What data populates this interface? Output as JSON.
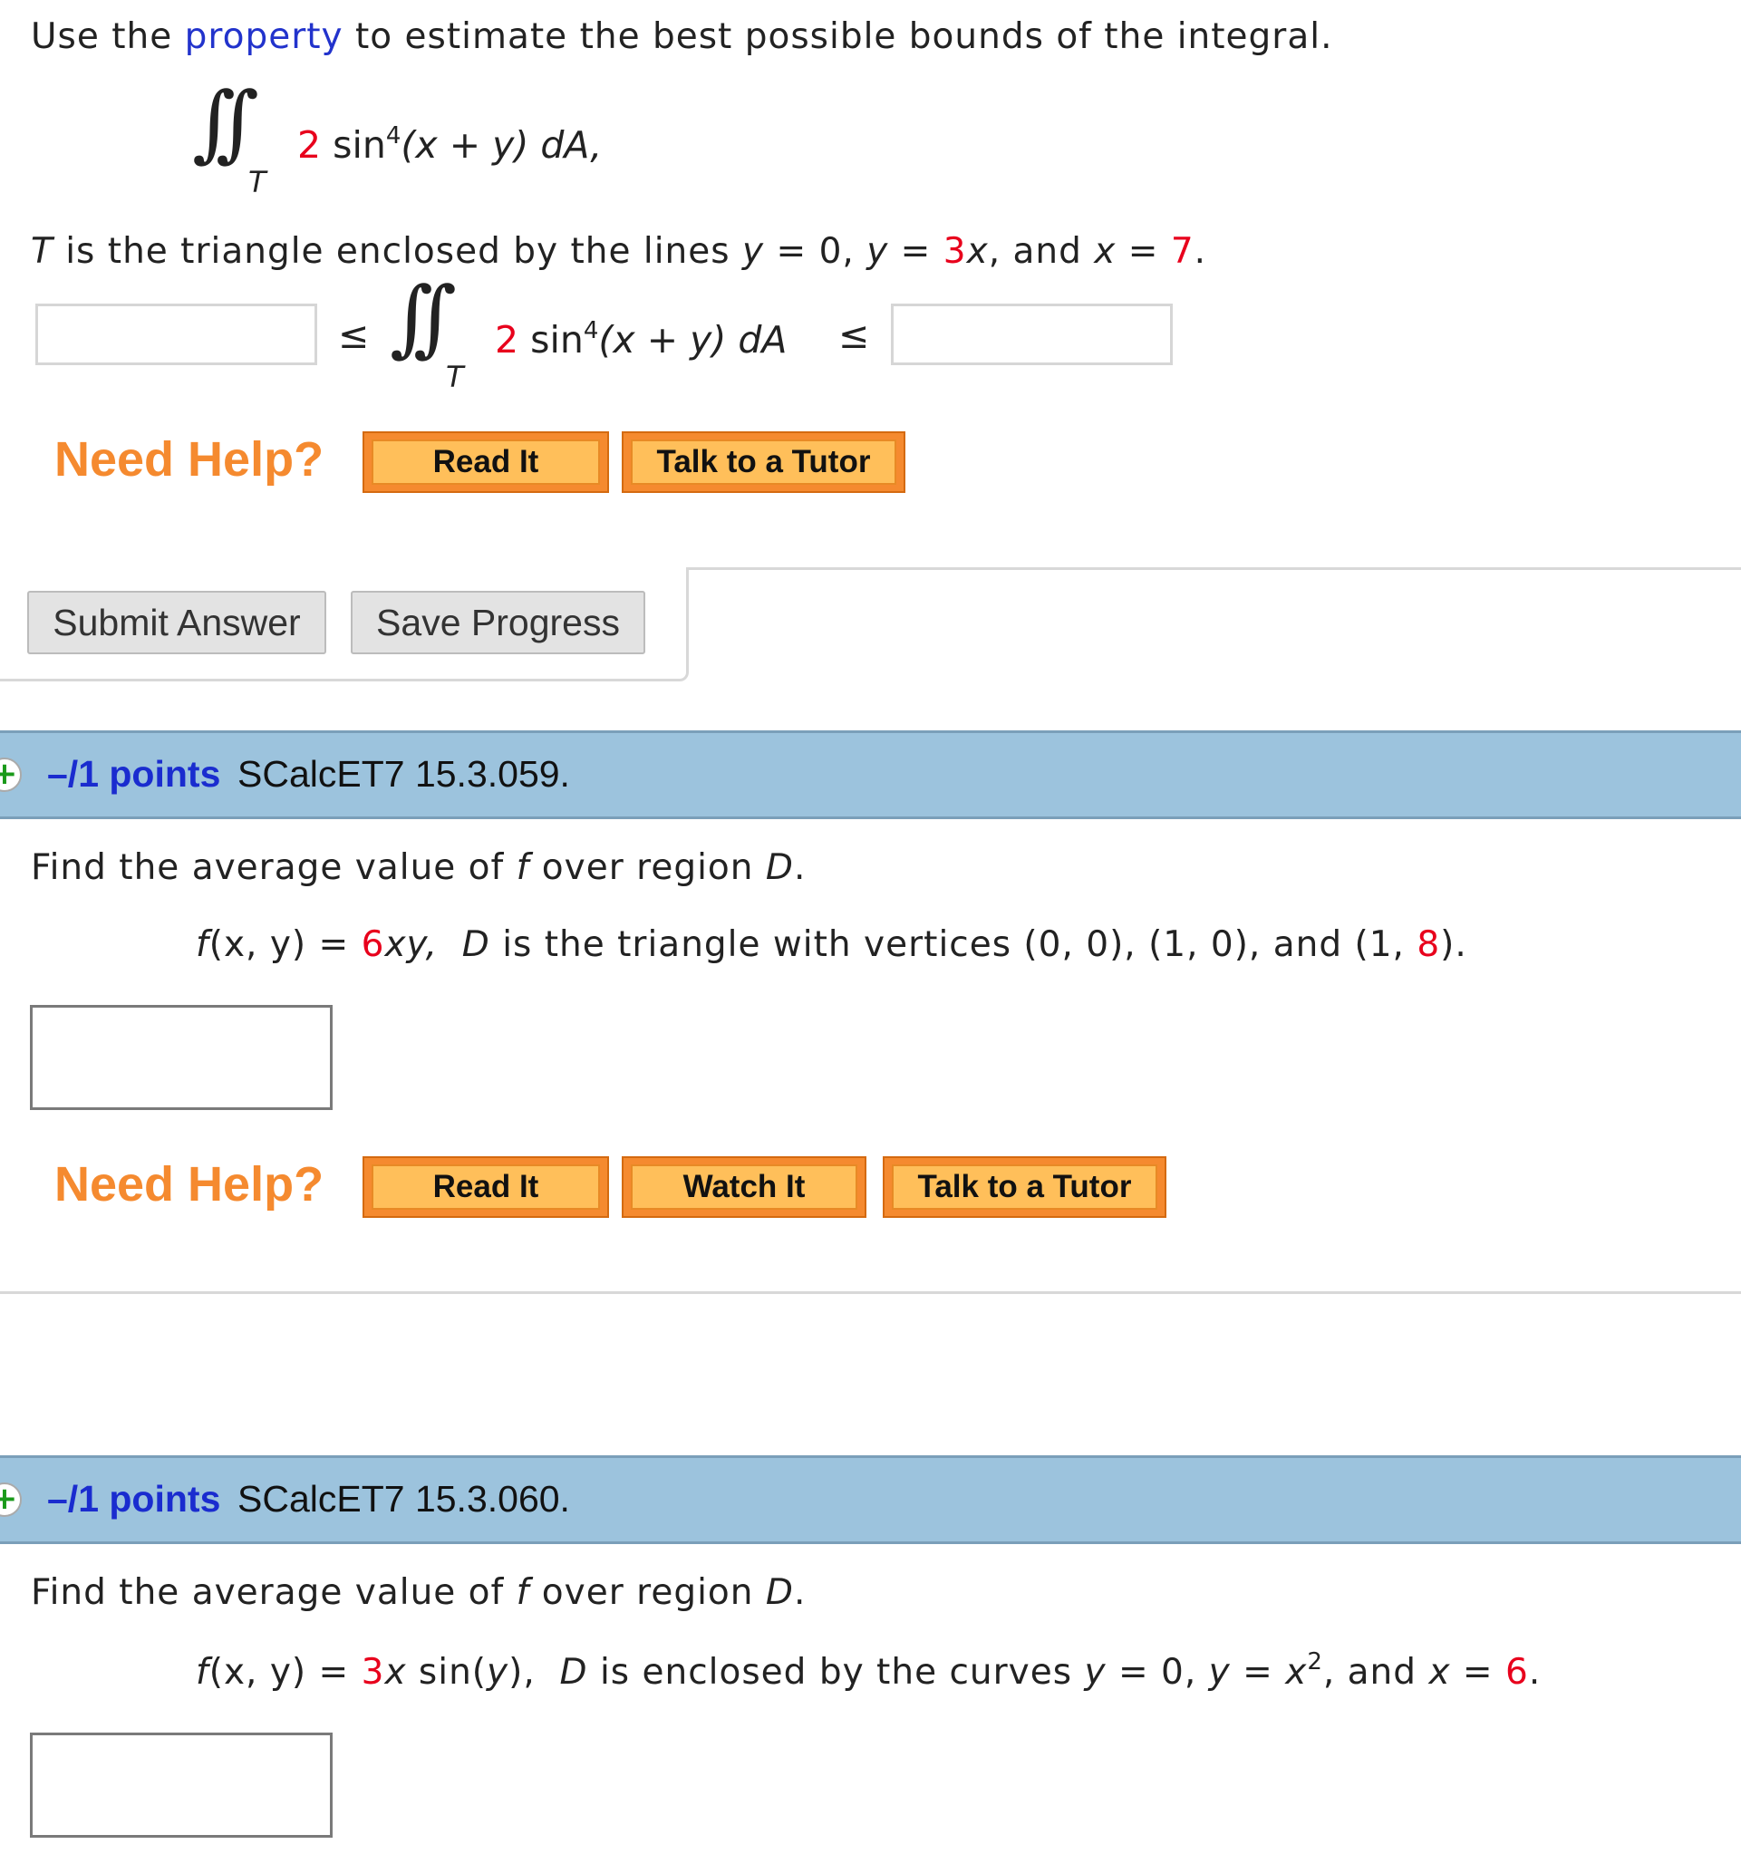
{
  "q1": {
    "intro_before": "Use the ",
    "property_link": "property",
    "intro_after": " to estimate the best possible bounds of the integral.",
    "integral_sign": "∫∫",
    "region": "T",
    "coef": "2",
    "func_sin": " sin",
    "power": "4",
    "func_arg": "(x + y) dA,",
    "triangle": {
      "T": "T",
      "text1": " is the triangle enclosed by the lines ",
      "y1": "y",
      "eq1": " = 0, ",
      "y2": "y",
      "eq2": " = ",
      "slope": "3",
      "x1": "x",
      "and": ", and ",
      "x2": "x",
      "eq3": " = ",
      "xval": "7",
      "end": "."
    },
    "bounds": {
      "leq1": "≤",
      "leq2": "≤",
      "integrand_end": "(x + y) dA",
      "lower_value": "",
      "upper_value": ""
    },
    "need_help": "Need Help?",
    "read_it": "Read It",
    "talk_tutor": "Talk to a Tutor",
    "submit": "Submit Answer",
    "save": "Save Progress"
  },
  "q2": {
    "plus": "+",
    "points": "–/1 points",
    "id": "SCalcET7 15.3.059.",
    "prompt_a": "Find the average value of ",
    "prompt_f": "f",
    "prompt_b": " over region ",
    "prompt_D": "D",
    "prompt_end": ".",
    "fx": "f",
    "fargs": "(x, y)",
    "eq": " = ",
    "coef": "6",
    "vars": "xy,",
    "D": "D",
    "desc_a": " is the triangle with vertices (0, 0), (1, 0), and (1, ",
    "vertex_y": "8",
    "desc_end": ").",
    "answer": "",
    "need_help": "Need Help?",
    "read_it": "Read It",
    "watch_it": "Watch It",
    "talk_tutor": "Talk to a Tutor"
  },
  "q3": {
    "plus": "+",
    "points": "–/1 points",
    "id": "SCalcET7 15.3.060.",
    "prompt_a": "Find the average value of ",
    "prompt_f": "f",
    "prompt_b": " over region ",
    "prompt_D": "D",
    "prompt_end": ".",
    "fx": "f",
    "fargs": "(x, y)",
    "eq": " = ",
    "coef": "3",
    "x": "x",
    "sin": " sin(",
    "y": "y",
    "close": "),",
    "D": "D",
    "desc_a": " is enclosed by the curves ",
    "y1": "y",
    "eq1": " = 0,  ",
    "y2": "y",
    "eq2": " = ",
    "x2": "x",
    "exp": "2",
    "and": ",  and ",
    "x3": "x",
    "eq3": " = ",
    "xval": "6",
    "end": ".",
    "answer": ""
  },
  "colors": {
    "accent_red": "#e8001c",
    "link_blue": "#2233cc",
    "need_help_orange": "#f58a2f",
    "question_bar": "#9cc3dd",
    "points_blue": "#1a2ccf"
  }
}
